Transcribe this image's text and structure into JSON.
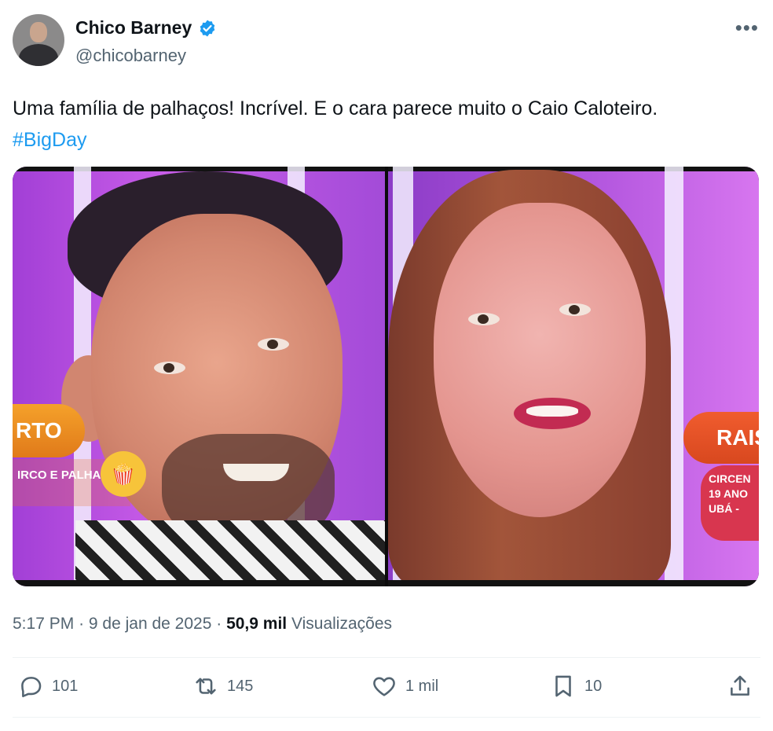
{
  "author": {
    "display_name": "Chico Barney",
    "handle": "@chicobarney",
    "verified": true,
    "verified_color": "#1d9bf0"
  },
  "tweet": {
    "text": "Uma família de palhaços! Incrível. E o cara parece muito o Caio Caloteiro.",
    "hashtag": "#BigDay",
    "hashtag_color": "#1d9bf0"
  },
  "media": {
    "left_panel": {
      "name_tag": "RTO",
      "subtitle": "IRCO E PALHAÇO"
    },
    "right_panel": {
      "name_tag": "RAIS",
      "subtitle_lines": [
        "CIRCEN",
        "19 ANO",
        "UBÁ -"
      ]
    }
  },
  "meta": {
    "time": "5:17 PM",
    "separator": "·",
    "date": "9 de jan de 2025",
    "views_count": "50,9 mil",
    "views_label": "Visualizações"
  },
  "actions": {
    "reply_count": "101",
    "retweet_count": "145",
    "like_count": "1 mil",
    "bookmark_count": "10"
  },
  "icons": {
    "more": "more-horizontal-icon",
    "reply": "reply-icon",
    "retweet": "retweet-icon",
    "like": "heart-icon",
    "bookmark": "bookmark-icon",
    "share": "share-icon"
  }
}
